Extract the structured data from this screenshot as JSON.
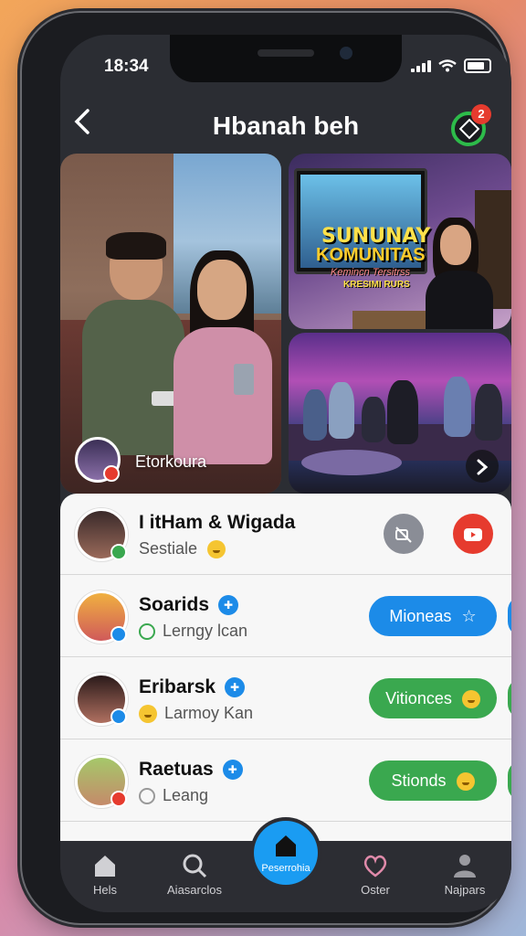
{
  "status_bar": {
    "time": "18:34"
  },
  "header": {
    "title": "Hbanah beh",
    "notification_count": "2"
  },
  "photos": {
    "caption": "Etorkoura"
  },
  "tv_screen": {
    "line1": "SUNUNAY",
    "line2": "KOMUNITAS",
    "line3": "Kemincn Tersitrss",
    "line4": "KRESIMI RURS"
  },
  "list": [
    {
      "name": "I itHam & Wigada",
      "sub": "Sestiale",
      "sub_emoji": "smile-emoji"
    },
    {
      "name": "Soarids",
      "sub": "Lerngy lcan",
      "button": "Mioneas",
      "button_color": "#1c8be8"
    },
    {
      "name": "Eribarsk",
      "sub": "Larmoy Kan",
      "button": "Vitionces",
      "button_color": "#3aa84f"
    },
    {
      "name": "Raetuas",
      "sub": "Leang",
      "button": "Stionds",
      "button_color": "#3aa84f"
    }
  ],
  "tabs": [
    {
      "label": "Hels",
      "icon": "home-icon"
    },
    {
      "label": "Aiasarclos",
      "icon": "search-icon"
    },
    {
      "label": "Peserrohia",
      "icon": "home-icon",
      "active": true
    },
    {
      "label": "Oster",
      "icon": "heart-icon"
    },
    {
      "label": "Najpars",
      "icon": "person-icon"
    }
  ],
  "colors": {
    "accent_blue": "#1c8be8",
    "accent_green": "#3aa84f",
    "danger_red": "#e63b2e"
  }
}
